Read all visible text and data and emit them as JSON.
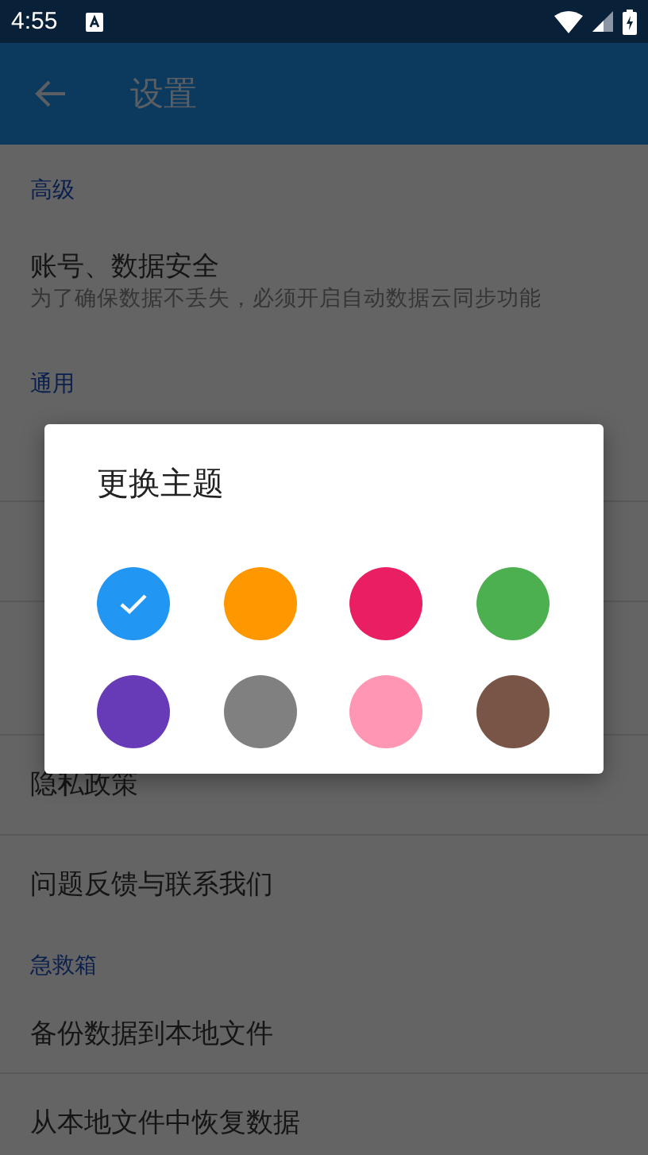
{
  "status_bar": {
    "time": "4:55"
  },
  "app_bar": {
    "title": "设置"
  },
  "sections": [
    {
      "header": "高级",
      "items": [
        {
          "title": "账号、数据安全",
          "subtitle": "为了确保数据不丢失，必须开启自动数据云同步功能"
        }
      ]
    },
    {
      "header": "通用",
      "items": [
        {
          "kind": "one_line"
        },
        {
          "kind": "one_line"
        },
        {
          "kind": "two_line"
        },
        {
          "title": "隐私政策"
        },
        {
          "title": "问题反馈与联系我们"
        }
      ]
    },
    {
      "header": "急救箱",
      "items": [
        {
          "title": "备份数据到本地文件"
        },
        {
          "title": "从本地文件中恢复数据"
        }
      ]
    }
  ],
  "dialog": {
    "title": "更换主题",
    "colors": [
      {
        "color": "#2196f3",
        "selected": true
      },
      {
        "color": "#ff9800",
        "selected": false
      },
      {
        "color": "#e91e63",
        "selected": false
      },
      {
        "color": "#4caf50",
        "selected": false
      },
      {
        "color": "#673ab7",
        "selected": false
      },
      {
        "color": "#808080",
        "selected": false
      },
      {
        "color": "#ff96b4",
        "selected": false
      },
      {
        "color": "#795548",
        "selected": false
      }
    ]
  }
}
